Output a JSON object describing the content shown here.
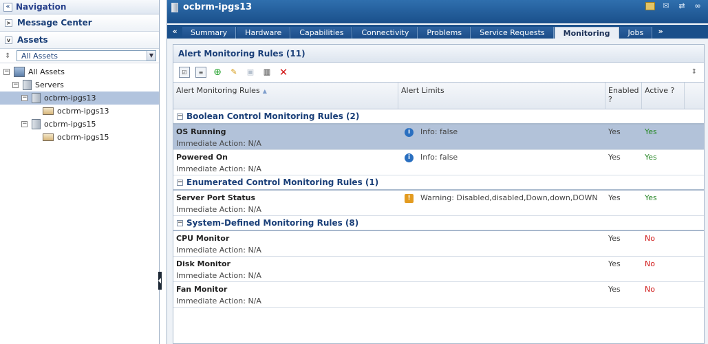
{
  "navigation": {
    "title": "Navigation",
    "sections": {
      "message_center": "Message Center",
      "assets": "Assets"
    },
    "filter_value": "All Assets",
    "tree": {
      "root": "All Assets",
      "servers": "Servers",
      "host1": "ocbrm-ipgs13",
      "host1_child": "ocbrm-ipgs13",
      "host2": "ocbrm-ipgs15",
      "host2_child": "ocbrm-ipgs15"
    }
  },
  "window": {
    "title": "ocbrm-ipgs13"
  },
  "tabs": [
    "Summary",
    "Hardware",
    "Capabilities",
    "Connectivity",
    "Problems",
    "Service Requests",
    "Monitoring",
    "Jobs"
  ],
  "active_tab": "Monitoring",
  "panel": {
    "title": "Alert Monitoring Rules (11)"
  },
  "columns": {
    "rules": "Alert Monitoring Rules",
    "limits": "Alert Limits",
    "enabled": "Enabled ?",
    "active": "Active ?"
  },
  "groups": [
    {
      "title": "Boolean Control Monitoring Rules (2)",
      "rows": [
        {
          "name": "OS Running",
          "action": "Immediate Action: N/A",
          "limit": "Info: false",
          "severity": "info",
          "enabled": "Yes",
          "active": "Yes"
        },
        {
          "name": "Powered On",
          "action": "Immediate Action: N/A",
          "limit": "Info: false",
          "severity": "info",
          "enabled": "Yes",
          "active": "Yes"
        }
      ]
    },
    {
      "title": "Enumerated Control Monitoring Rules (1)",
      "rows": [
        {
          "name": "Server Port Status",
          "action": "Immediate Action: N/A",
          "limit": "Warning: Disabled,disabled,Down,down,DOWN",
          "severity": "warning",
          "enabled": "Yes",
          "active": "Yes"
        }
      ]
    },
    {
      "title": "System-Defined Monitoring Rules (8)",
      "rows": [
        {
          "name": "CPU Monitor",
          "action": "Immediate Action: N/A",
          "limit": "",
          "severity": "",
          "enabled": "Yes",
          "active": "No"
        },
        {
          "name": "Disk Monitor",
          "action": "Immediate Action: N/A",
          "limit": "",
          "severity": "",
          "enabled": "Yes",
          "active": "No"
        },
        {
          "name": "Fan Monitor",
          "action": "Immediate Action: N/A",
          "limit": "",
          "severity": "",
          "enabled": "Yes",
          "active": "No"
        }
      ]
    }
  ],
  "colors": {
    "title_bar": "#1a4f8a",
    "selection": "#b2c2d9",
    "active_yes": "#2e8b2e",
    "active_no": "#d01818"
  }
}
